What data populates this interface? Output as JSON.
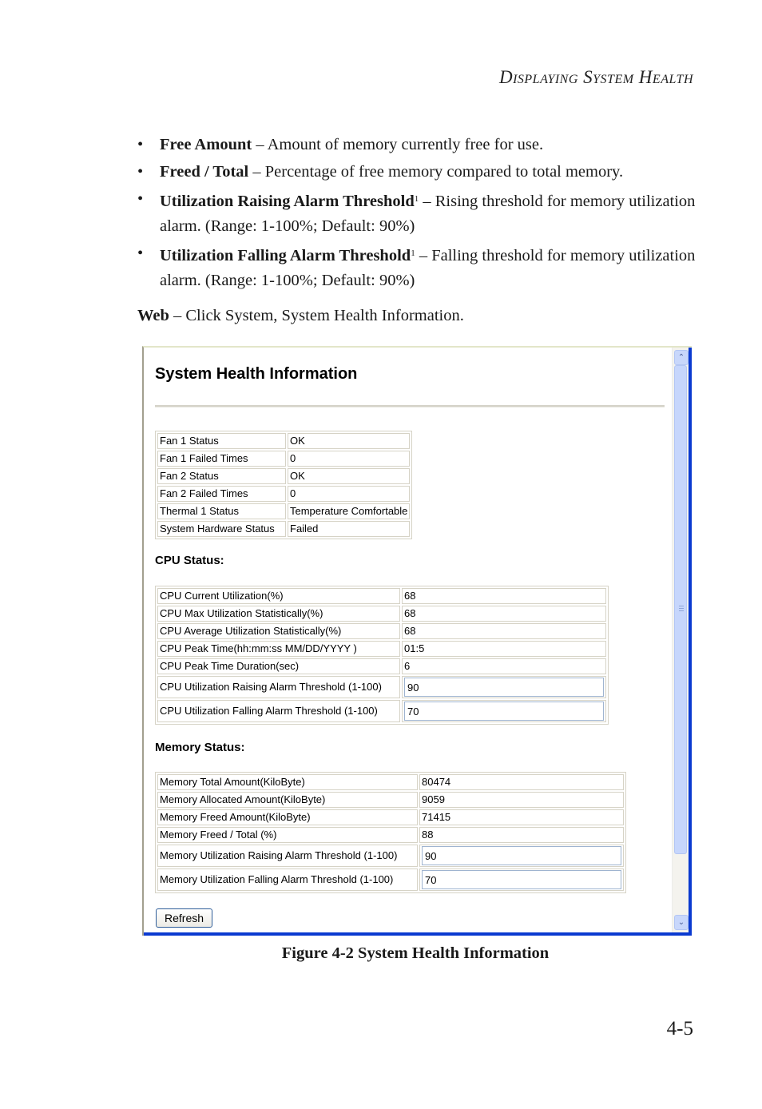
{
  "running_header": "Displaying System Health",
  "bullets": [
    {
      "term": "Free Amount",
      "sup": "",
      "desc": " – Amount of memory currently free for use."
    },
    {
      "term": "Freed / Total",
      "sup": "",
      "desc": " – Percentage of free memory compared to total memory."
    },
    {
      "term": "Utilization Raising Alarm Threshold",
      "sup": "1",
      "desc": " – Rising threshold for memory utilization alarm. (Range: 1-100%; Default: 90%)"
    },
    {
      "term": "Utilization Falling Alarm Threshold",
      "sup": "1",
      "desc": " – Falling threshold for memory utilization alarm. (Range: 1-100%; Default: 90%)"
    }
  ],
  "web": {
    "label": "Web",
    "text": " – Click System, System Health Information."
  },
  "screenshot": {
    "title": "System Health Information",
    "hardware": [
      {
        "label": "Fan 1 Status",
        "value": "OK"
      },
      {
        "label": "Fan 1 Failed Times",
        "value": "0"
      },
      {
        "label": "Fan 2 Status",
        "value": "OK"
      },
      {
        "label": "Fan 2 Failed Times",
        "value": "0"
      },
      {
        "label": "Thermal 1 Status",
        "value": "Temperature Comfortable"
      },
      {
        "label": "System Hardware Status",
        "value": "Failed"
      }
    ],
    "cpu": {
      "title": "CPU Status:",
      "rows": [
        {
          "label": "CPU Current Utilization(%)",
          "value": "68"
        },
        {
          "label": "CPU Max Utilization Statistically(%)",
          "value": "68"
        },
        {
          "label": "CPU Average Utilization Statistically(%)",
          "value": "68"
        },
        {
          "label": "CPU Peak Time(hh:mm:ss MM/DD/YYYY )",
          "value": "01:5"
        },
        {
          "label": "CPU Peak Time Duration(sec)",
          "value": "6"
        }
      ],
      "inputs": [
        {
          "label": "CPU Utilization Raising Alarm Threshold (1-100)",
          "value": "90"
        },
        {
          "label": "CPU Utilization Falling Alarm Threshold (1-100)",
          "value": "70"
        }
      ]
    },
    "memory": {
      "title": "Memory Status:",
      "rows": [
        {
          "label": "Memory Total Amount(KiloByte)",
          "value": "80474"
        },
        {
          "label": "Memory Allocated Amount(KiloByte)",
          "value": "9059"
        },
        {
          "label": "Memory Freed Amount(KiloByte)",
          "value": "71415"
        },
        {
          "label": "Memory Freed / Total (%)",
          "value": "88"
        }
      ],
      "inputs": [
        {
          "label": "Memory Utilization Raising Alarm Threshold (1-100)",
          "value": "90"
        },
        {
          "label": "Memory Utilization Falling Alarm Threshold (1-100)",
          "value": "70"
        }
      ]
    },
    "refresh_label": "Refresh",
    "scroll_up_icon": "chevron-up",
    "scroll_down_icon": "chevron-down"
  },
  "caption": "Figure 4-2  System Health Information",
  "page_number": "4-5"
}
